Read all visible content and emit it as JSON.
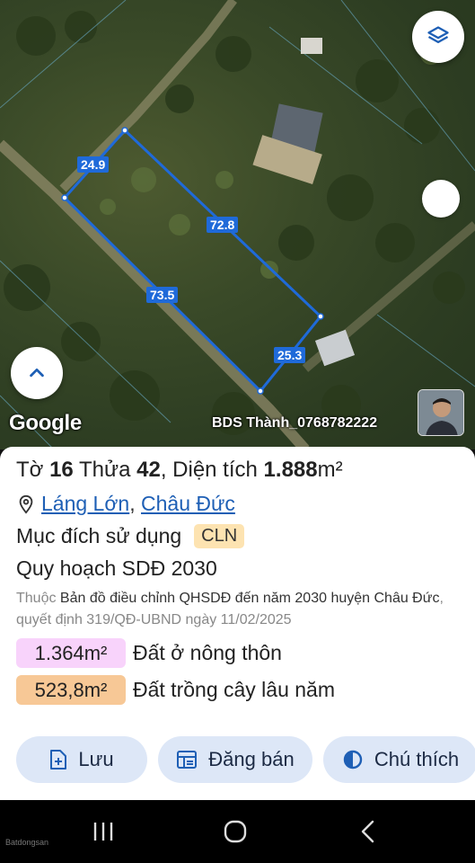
{
  "map": {
    "segments": [
      "24.9",
      "72.8",
      "73.5",
      "25.3"
    ],
    "google_label": "Google",
    "watermark": "BDS Thành_0768782222"
  },
  "parcel": {
    "to_label": "Tờ",
    "to_value": "16",
    "thua_label": "Thửa",
    "thua_value": "42",
    "area_label": "Diện tích",
    "area_value": "1.888",
    "area_unit": "m²",
    "location": {
      "commune": "Láng Lớn",
      "sep": ",",
      "district": "Châu Đức"
    },
    "purpose_label": "Mục đích sử dụng",
    "purpose_code": "CLN",
    "plan_title": "Quy hoạch SDĐ 2030",
    "plan_prefix": "Thuộc",
    "plan_doc": "Bản đồ điều chỉnh QHSDĐ đến năm 2030 huyện Châu Đức",
    "plan_decision": ", quyết định 319/QĐ-UBND ngày 11/02/2025",
    "areas": [
      {
        "value": "1.364m²",
        "label": "Đất ở nông thôn",
        "color": "#f8d3fb"
      },
      {
        "value": "523,8m²",
        "label": "Đất trồng cây lâu năm",
        "color": "#f7c896"
      }
    ]
  },
  "actions": {
    "save": "Lưu",
    "sell": "Đăng bán",
    "legend": "Chú thích"
  },
  "nav": {
    "brand": "Batdongsan"
  },
  "colors": {
    "accent": "#1f6ad9",
    "link": "#1e5fb5",
    "button_bg": "#dde7f7"
  }
}
